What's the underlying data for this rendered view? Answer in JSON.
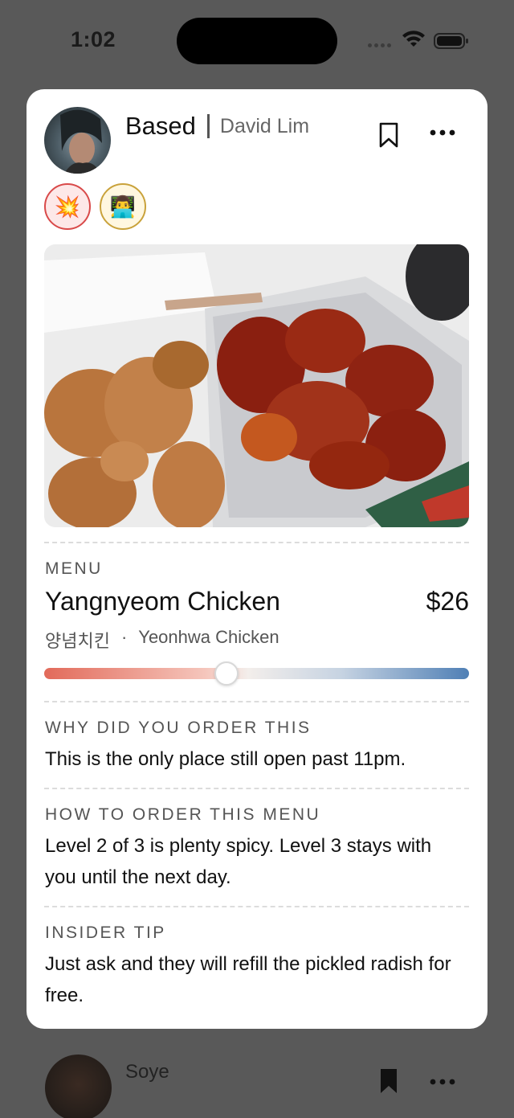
{
  "status_bar": {
    "time": "1:02"
  },
  "post": {
    "app_name": "Based",
    "author": "David Lim",
    "badges": [
      {
        "emoji": "💥",
        "icon": "explosion-icon"
      },
      {
        "emoji": "👨‍💻",
        "icon": "technologist-icon"
      }
    ],
    "menu_label": "MENU",
    "menu_name": "Yangnyeom Chicken",
    "price": "$26",
    "korean_name": "양념치킨",
    "restaurant": "Yeonhwa Chicken",
    "sub_separator": "·",
    "spice_level": 0.43,
    "why_label": "WHY DID YOU ORDER THIS",
    "why_text": "This is the only place still open past 11pm.",
    "how_label": "HOW TO ORDER THIS MENU",
    "how_text": "Level 2 of 3 is plenty spicy. Level 3 stays with you until the next day.",
    "tip_label": "INSIDER TIP",
    "tip_text": "Just ask and they will refill the pickled radish for free."
  },
  "next_post": {
    "author": "Soye"
  },
  "colors": {
    "background": "#595959",
    "card": "#ffffff",
    "slider_start": "#e26a5a",
    "slider_end": "#4f7fb5"
  }
}
